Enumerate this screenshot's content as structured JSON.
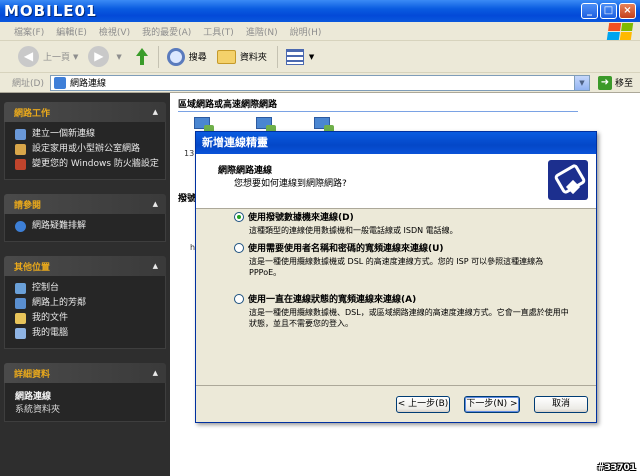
{
  "titlebar": {
    "logo_text": "MOBILE01",
    "buttons": [
      "_",
      "□",
      "×"
    ]
  },
  "menubar": {
    "items": [
      "檔案(F)",
      "編輯(E)",
      "檢視(V)",
      "我的最愛(A)",
      "工具(T)",
      "進階(N)",
      "說明(H)"
    ]
  },
  "toolbar": {
    "back_label": "上一頁",
    "search_label": "搜尋",
    "folders_label": "資料夾"
  },
  "addressbar": {
    "label": "網址(D)",
    "value": "網路連線",
    "go_label": "移至"
  },
  "sidebar": {
    "network_tasks": {
      "title": "網路工作",
      "items": [
        "建立一個新連線",
        "設定家用或小型辦公室網路",
        "變更您的 Windows 防火牆設定"
      ]
    },
    "see_also": {
      "title": "請參閱",
      "items": [
        "網路疑難排解"
      ]
    },
    "other_places": {
      "title": "其他位置",
      "items": [
        "控制台",
        "網路上的芳鄰",
        "我的文件",
        "我的電腦"
      ]
    },
    "details": {
      "title": "詳細資料",
      "name": "網路連線",
      "sub": "系統資料夾"
    }
  },
  "main": {
    "section_title": "區域網路或高速網際網路",
    "section2_title": "撥號",
    "conn_label_1": "13",
    "conn_label_2": "h"
  },
  "dialog": {
    "title": "新增連線精靈",
    "header_title": "網際網路連線",
    "header_sub": "您想要如何連線到網際網路?",
    "options": [
      {
        "label": "使用撥號數據機來連線(D)",
        "desc": "這種類型的連線使用數據機和一般電話線或 ISDN 電話線。",
        "checked": true
      },
      {
        "label": "使用需要使用者名稱和密碼的寬頻連線來連線(U)",
        "desc": "這是一種使用纜線數據機或 DSL 的高速度連線方式。您的 ISP 可以參照這種連線為 PPPoE。",
        "checked": false
      },
      {
        "label": "使用一直在連線狀態的寬頻連線來連線(A)",
        "desc": "這是一種使用纜線數據機、DSL，或區域網路連線的高速度連線方式。它會一直處於使用中狀態，並且不需要您的登入。",
        "checked": false
      }
    ],
    "buttons": {
      "back": "< 上一步(B)",
      "next": "下一步(N) >",
      "cancel": "取消"
    }
  },
  "watermark": "#33701",
  "colors": {
    "sidebar_bg": "#2e2e2e",
    "panel_title": "#e8a81c",
    "titlebar_blue": "#0a5ce0"
  }
}
